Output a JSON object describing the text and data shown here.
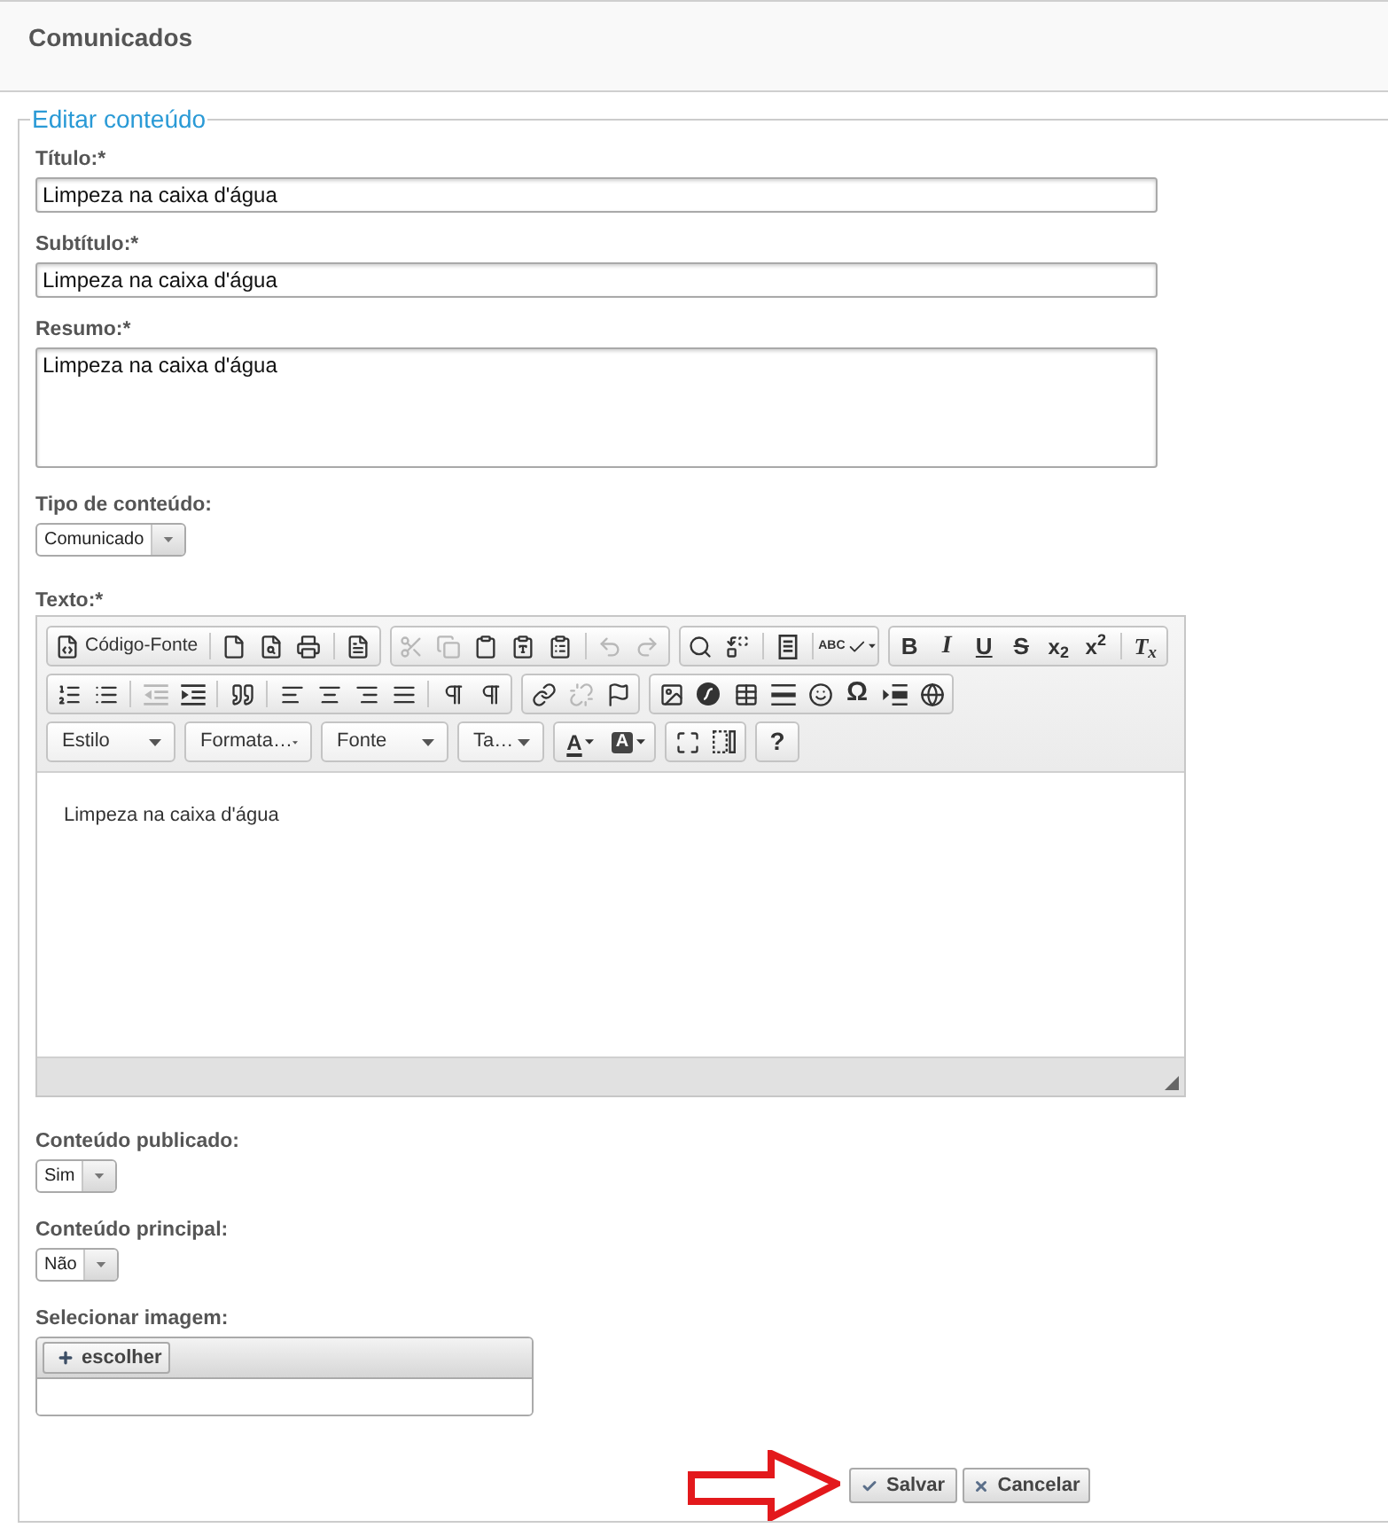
{
  "page": {
    "title": "Comunicados"
  },
  "form": {
    "legend": "Editar conteúdo",
    "fields": [
      {
        "kind": "text",
        "label": "Título:*",
        "value": "Limpeza na caixa d'água"
      },
      {
        "kind": "text",
        "label": "Subtítulo:*",
        "value": "Limpeza na caixa d'água"
      },
      {
        "kind": "textarea",
        "label": "Resumo:*",
        "value": "Limpeza na caixa d'água"
      },
      {
        "kind": "select",
        "label": "Tipo de conteúdo:",
        "value": "Comunicado"
      },
      {
        "kind": "editor",
        "label": "Texto:*",
        "toolbar": [
          {
            "groups": [
              {
                "kind": "buttons",
                "sections": [
                  [
                    {
                      "kind": "source",
                      "label": "Código-Fonte",
                      "disabled": false
                    }
                  ],
                  [
                    {
                      "kind": "newpage",
                      "disabled": false
                    },
                    {
                      "kind": "preview",
                      "disabled": false
                    },
                    {
                      "kind": "print",
                      "disabled": false
                    }
                  ],
                  [
                    {
                      "kind": "templates",
                      "disabled": false
                    }
                  ]
                ]
              },
              {
                "kind": "buttons",
                "sections": [
                  [
                    {
                      "kind": "cut",
                      "disabled": true
                    },
                    {
                      "kind": "copy",
                      "disabled": true
                    },
                    {
                      "kind": "paste",
                      "disabled": false
                    },
                    {
                      "kind": "pastetext",
                      "disabled": false
                    },
                    {
                      "kind": "pasteword",
                      "disabled": false
                    }
                  ],
                  [
                    {
                      "kind": "undo",
                      "disabled": true
                    },
                    {
                      "kind": "redo",
                      "disabled": true
                    }
                  ]
                ]
              },
              {
                "kind": "buttons",
                "sections": [
                  [
                    {
                      "kind": "find",
                      "disabled": false
                    },
                    {
                      "kind": "replace",
                      "disabled": false
                    }
                  ],
                  [
                    {
                      "kind": "selectall",
                      "disabled": false
                    }
                  ],
                  [
                    {
                      "kind": "spellcheck",
                      "label": "ABC",
                      "disabled": false
                    }
                  ]
                ]
              },
              {
                "kind": "buttons",
                "sections": [
                  [
                    {
                      "kind": "bold",
                      "label": "B",
                      "disabled": false
                    },
                    {
                      "kind": "italic",
                      "label": "I",
                      "disabled": false
                    },
                    {
                      "kind": "underline",
                      "label": "U",
                      "disabled": false
                    },
                    {
                      "kind": "strike",
                      "label": "S",
                      "disabled": false
                    },
                    {
                      "kind": "subscript",
                      "label": "x$_{2}$",
                      "disabled": false
                    },
                    {
                      "kind": "superscript",
                      "label": "x$^{2}$",
                      "disabled": false
                    }
                  ],
                  [
                    {
                      "kind": "removeformat",
                      "label": "T$_{x}$",
                      "disabled": false
                    }
                  ]
                ]
              }
            ]
          },
          {
            "groups": [
              {
                "kind": "buttons",
                "sections": [
                  [
                    {
                      "kind": "numbered",
                      "disabled": false
                    },
                    {
                      "kind": "bulleted",
                      "disabled": false
                    }
                  ],
                  [
                    {
                      "kind": "outdent",
                      "disabled": true
                    },
                    {
                      "kind": "indent",
                      "disabled": false
                    }
                  ],
                  [
                    {
                      "kind": "blockquote",
                      "disabled": false
                    }
                  ],
                  [
                    {
                      "kind": "alignleft",
                      "disabled": false
                    },
                    {
                      "kind": "aligncenter",
                      "disabled": false
                    },
                    {
                      "kind": "alignright",
                      "disabled": false
                    },
                    {
                      "kind": "justify",
                      "disabled": false
                    }
                  ],
                  [
                    {
                      "kind": "ltr",
                      "disabled": false
                    },
                    {
                      "kind": "rtl",
                      "disabled": false
                    }
                  ]
                ]
              },
              {
                "kind": "buttons",
                "sections": [
                  [
                    {
                      "kind": "link",
                      "disabled": false
                    },
                    {
                      "kind": "unlink",
                      "disabled": true
                    },
                    {
                      "kind": "anchor",
                      "disabled": false
                    }
                  ]
                ]
              },
              {
                "kind": "buttons",
                "sections": [
                  [
                    {
                      "kind": "image",
                      "disabled": false
                    },
                    {
                      "kind": "flash",
                      "disabled": false
                    },
                    {
                      "kind": "table",
                      "disabled": false
                    },
                    {
                      "kind": "rule",
                      "disabled": false
                    },
                    {
                      "kind": "smiley",
                      "disabled": false
                    },
                    {
                      "kind": "specialchar",
                      "label": "Ω",
                      "disabled": false
                    },
                    {
                      "kind": "pagebreak",
                      "disabled": false
                    },
                    {
                      "kind": "iframe",
                      "disabled": false
                    }
                  ]
                ]
              }
            ]
          },
          {
            "groups": [
              {
                "kind": "combo",
                "label": "Estilo"
              },
              {
                "kind": "combo",
                "label": "Formata…"
              },
              {
                "kind": "combo",
                "label": "Fonte"
              },
              {
                "kind": "combo",
                "label": "Ta…"
              },
              {
                "kind": "buttons",
                "sections": [
                  [
                    {
                      "kind": "textcolor",
                      "label": "A",
                      "disabled": false
                    },
                    {
                      "kind": "bgcolor",
                      "label": "A",
                      "disabled": false
                    }
                  ]
                ]
              },
              {
                "kind": "buttons",
                "sections": [
                  [
                    {
                      "kind": "maximize",
                      "disabled": false
                    },
                    {
                      "kind": "showblocks",
                      "disabled": false
                    }
                  ]
                ]
              },
              {
                "kind": "buttons",
                "sections": [
                  [
                    {
                      "kind": "help",
                      "label": "?",
                      "disabled": false
                    }
                  ]
                ]
              }
            ]
          }
        ],
        "content": "Limpeza na caixa d'água"
      },
      {
        "kind": "select",
        "label": "Conteúdo publicado:",
        "value": "Sim"
      },
      {
        "kind": "select",
        "label": "Conteúdo principal:",
        "value": "Não"
      },
      {
        "kind": "upload",
        "label": "Selecionar imagem:",
        "button": "escolher"
      }
    ]
  },
  "buttons": [
    {
      "kind": "save",
      "label": "Salvar"
    },
    {
      "kind": "cancel",
      "label": "Cancelar"
    }
  ]
}
